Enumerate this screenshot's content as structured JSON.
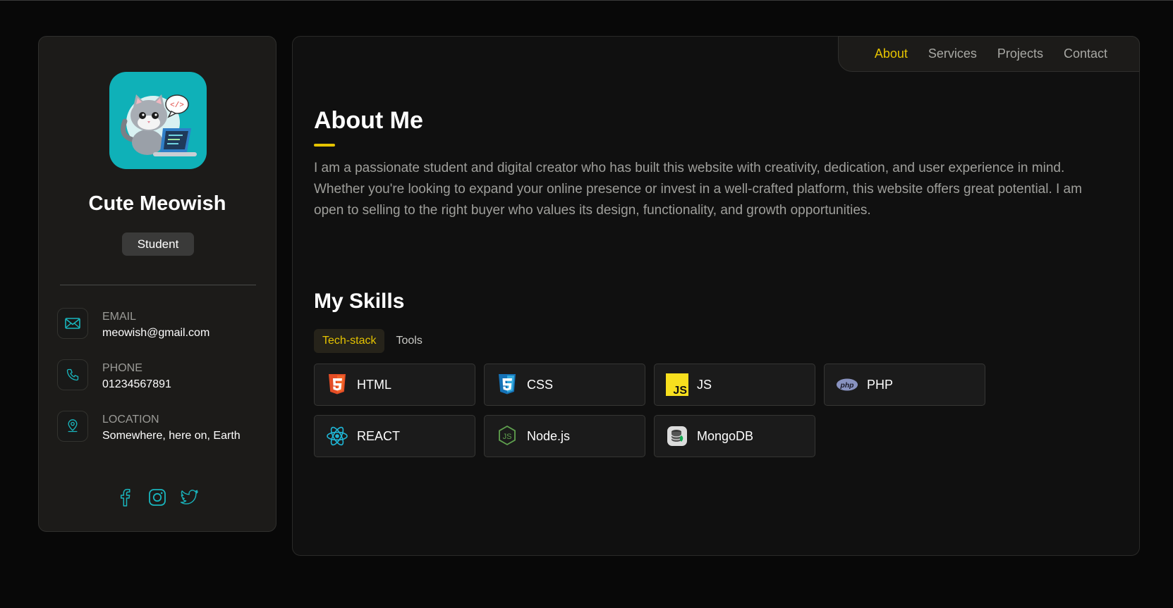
{
  "profile": {
    "name": "Cute Meowish",
    "role": "Student"
  },
  "contacts": [
    {
      "label": "EMAIL",
      "value": "meowish@gmail.com",
      "icon": "mail-icon"
    },
    {
      "label": "PHONE",
      "value": "01234567891",
      "icon": "phone-icon"
    },
    {
      "label": "LOCATION",
      "value": "Somewhere, here on, Earth",
      "icon": "location-pin-icon"
    }
  ],
  "socials": [
    "facebook-icon",
    "instagram-icon",
    "twitter-icon"
  ],
  "nav": {
    "items": [
      {
        "label": "About",
        "active": true
      },
      {
        "label": "Services",
        "active": false
      },
      {
        "label": "Projects",
        "active": false
      },
      {
        "label": "Contact",
        "active": false
      }
    ]
  },
  "about": {
    "title": "About Me",
    "text": "I am a passionate student and digital creator who has built this website with creativity, dedication, and user experience in mind. Whether you're looking to expand your online presence or invest in a well-crafted platform, this website offers great potential. I am open to selling to the right buyer who values its design, functionality, and growth opportunities."
  },
  "skills": {
    "title": "My Skills",
    "tabs": [
      {
        "label": "Tech-stack",
        "active": true
      },
      {
        "label": "Tools",
        "active": false
      }
    ],
    "items": [
      {
        "name": "HTML",
        "icon": "html5-icon"
      },
      {
        "name": "CSS",
        "icon": "css3-icon"
      },
      {
        "name": "JS",
        "icon": "javascript-icon"
      },
      {
        "name": "PHP",
        "icon": "php-icon"
      },
      {
        "name": "REACT",
        "icon": "react-icon"
      },
      {
        "name": "Node.js",
        "icon": "nodejs-icon"
      },
      {
        "name": "MongoDB",
        "icon": "mongodb-icon"
      }
    ]
  },
  "colors": {
    "accent": "#e5c300",
    "teal": "#0fb1b8",
    "background": "#080808",
    "panel": "#1c1b19"
  }
}
